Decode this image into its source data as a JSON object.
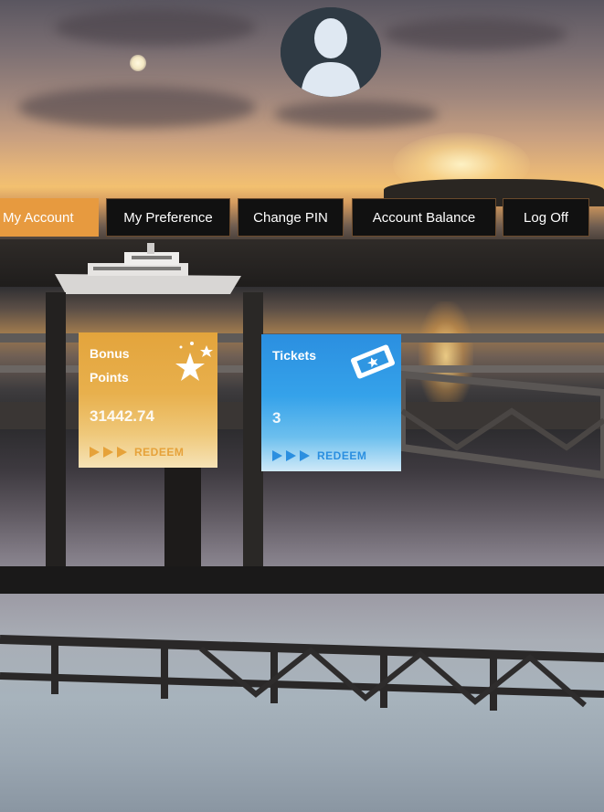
{
  "nav": {
    "tabs": [
      {
        "label": "My Account",
        "active": true
      },
      {
        "label": "My Preference",
        "active": false
      },
      {
        "label": "Change PIN",
        "active": false
      },
      {
        "label": "Account Balance",
        "active": false
      },
      {
        "label": "Log Off",
        "active": false
      }
    ]
  },
  "tiles": {
    "bonus": {
      "title_line1": "Bonus",
      "title_line2": "Points",
      "value": "31442.74",
      "action": "REDEEM",
      "icon": "star-icon",
      "color": "#e6a23a"
    },
    "tickets": {
      "title": "Tickets",
      "value": "3",
      "action": "REDEEM",
      "icon": "ticket-icon",
      "color": "#2b8fe0"
    }
  },
  "profile": {
    "icon": "user-silhouette-icon"
  },
  "theme": {
    "accent": "#e79a3f",
    "tab_bg": "#111111"
  }
}
